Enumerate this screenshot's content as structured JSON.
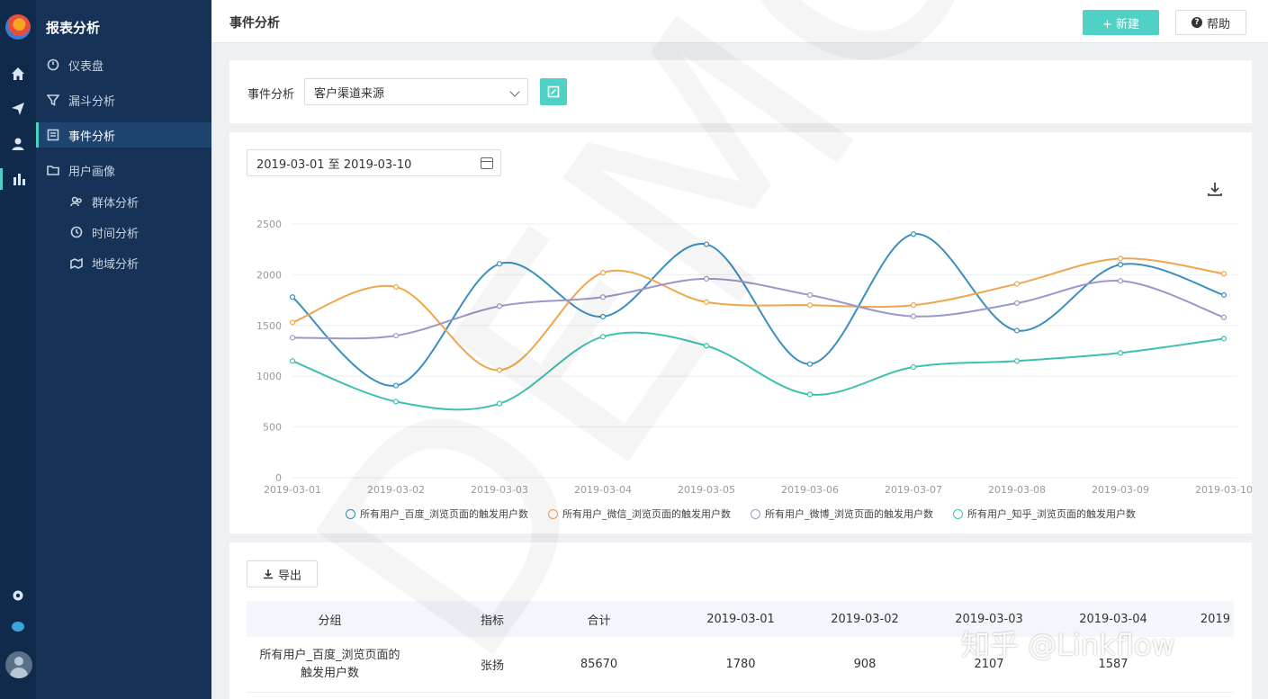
{
  "sidebar": {
    "title": "报表分析",
    "items": [
      {
        "label": "仪表盘"
      },
      {
        "label": "漏斗分析"
      },
      {
        "label": "事件分析"
      },
      {
        "label": "用户画像"
      },
      {
        "label": "群体分析"
      },
      {
        "label": "时间分析"
      },
      {
        "label": "地域分析"
      }
    ]
  },
  "topbar": {
    "page_title": "事件分析",
    "new_label": "+ 新建",
    "help_label": "帮助"
  },
  "filter": {
    "event_label": "事件分析",
    "selected_event": "客户渠道来源"
  },
  "date_range": "2019-03-01 至 2019-03-10",
  "chart_data": {
    "type": "line",
    "x": [
      "2019-03-01",
      "2019-03-02",
      "2019-03-03",
      "2019-03-04",
      "2019-03-05",
      "2019-03-06",
      "2019-03-07",
      "2019-03-08",
      "2019-03-09",
      "2019-03-10"
    ],
    "ylim": [
      0,
      2500
    ],
    "yticks": [
      0,
      500,
      1000,
      1500,
      2000,
      2500
    ],
    "grid": true,
    "legend_position": "bottom",
    "series": [
      {
        "name": "所有用户_百度_浏览页面的触发用户数",
        "color": "#3a8fc0",
        "values": [
          1780,
          908,
          2107,
          1587,
          2300,
          1120,
          2400,
          1450,
          2100,
          1800
        ]
      },
      {
        "name": "所有用户_微信_浏览页面的触发用户数",
        "color": "#f0a64c",
        "values": [
          1530,
          1880,
          1060,
          2020,
          1730,
          1700,
          1700,
          1910,
          2160,
          2010
        ]
      },
      {
        "name": "所有用户_微博_浏览页面的触发用户数",
        "color": "#9c97c7",
        "values": [
          1380,
          1400,
          1690,
          1780,
          1960,
          1800,
          1590,
          1720,
          1940,
          1580
        ]
      },
      {
        "name": "所有用户_知乎_浏览页面的触发用户数",
        "color": "#3fbfb4",
        "values": [
          1150,
          750,
          730,
          1390,
          1300,
          820,
          1090,
          1150,
          1230,
          1370
        ]
      }
    ]
  },
  "table": {
    "export_label": "导出",
    "headers": [
      "分组",
      "指标",
      "合计",
      "2019-03-01",
      "2019-03-02",
      "2019-03-03",
      "2019-03-04",
      "2019"
    ],
    "rows": [
      [
        "所有用户_百度_浏览页面的触发用户数",
        "张扬",
        "85670",
        "1780",
        "908",
        "2107",
        "1587",
        ""
      ]
    ]
  },
  "watermarks": {
    "demo": "DEMO",
    "zhihu": "知乎 @Linkflow"
  },
  "colors": {
    "accent": "#4fd1c5",
    "sidebar_bg": "#163256",
    "rail_bg": "#0f2a4a"
  }
}
